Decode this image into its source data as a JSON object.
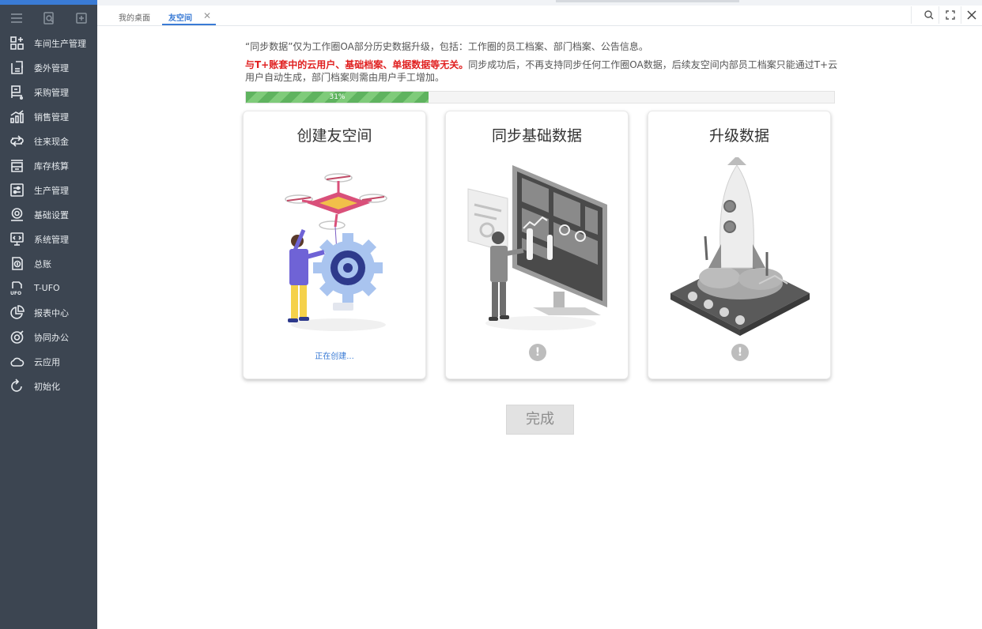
{
  "sidebar": {
    "tools": [
      {
        "icon": "hamburger-menu-icon"
      },
      {
        "icon": "search-doc-icon"
      },
      {
        "icon": "new-window-icon"
      }
    ],
    "items": [
      {
        "label": "车间生产管理",
        "icon": "workshop-grid-icon"
      },
      {
        "label": "委外管理",
        "icon": "outsource-doc-icon"
      },
      {
        "label": "采购管理",
        "icon": "purchase-cart-icon"
      },
      {
        "label": "销售管理",
        "icon": "sales-chart-icon"
      },
      {
        "label": "往来现金",
        "icon": "transfer-arrows-icon"
      },
      {
        "label": "库存核算",
        "icon": "inventory-icon"
      },
      {
        "label": "生产管理",
        "icon": "production-sliders-icon"
      },
      {
        "label": "基础设置",
        "icon": "settings-gear-icon"
      },
      {
        "label": "系统管理",
        "icon": "system-monitor-icon"
      },
      {
        "label": "总账",
        "icon": "ledger-icon"
      },
      {
        "label": "T-UFO",
        "icon": "ufo-doc-icon"
      },
      {
        "label": "报表中心",
        "icon": "pie-report-icon"
      },
      {
        "label": "协同办公",
        "icon": "collab-target-icon"
      },
      {
        "label": "云应用",
        "icon": "cloud-icon"
      },
      {
        "label": "初始化",
        "icon": "refresh-init-icon"
      }
    ],
    "colors": {
      "bg": "#3c4551",
      "accent": "#3a7bd5"
    }
  },
  "tabs": {
    "desktop": "我的桌面",
    "active": "友空间",
    "close": "✕"
  },
  "window_controls": [
    {
      "icon": "search-icon"
    },
    {
      "icon": "fullscreen-icon"
    },
    {
      "icon": "close-icon"
    }
  ],
  "main": {
    "notice_line1": "“同步数据”仅为工作圈OA部分历史数据升级，包括：工作圈的员工档案、部门档案、公告信息。",
    "notice_red": "与T+账套中的云用户、基础档案、单据数据等无关。",
    "notice_rest": "同步成功后，不再支持同步任何工作圈OA数据，后续友空间内部员工档案只能通过T+云用户自动生成，部门档案则需由用户手工增加。",
    "progress": {
      "percent": 31,
      "label": "31%"
    },
    "cards": [
      {
        "title": "创建友空间",
        "status": "正在创建...",
        "state": "in-progress",
        "illustration": "drone-gear-illustration"
      },
      {
        "title": "同步基础数据",
        "status": "!",
        "state": "pending",
        "illustration": "monitor-dashboard-illustration"
      },
      {
        "title": "升级数据",
        "status": "!",
        "state": "pending",
        "illustration": "rocket-launch-illustration"
      }
    ],
    "done_button": "完成"
  }
}
